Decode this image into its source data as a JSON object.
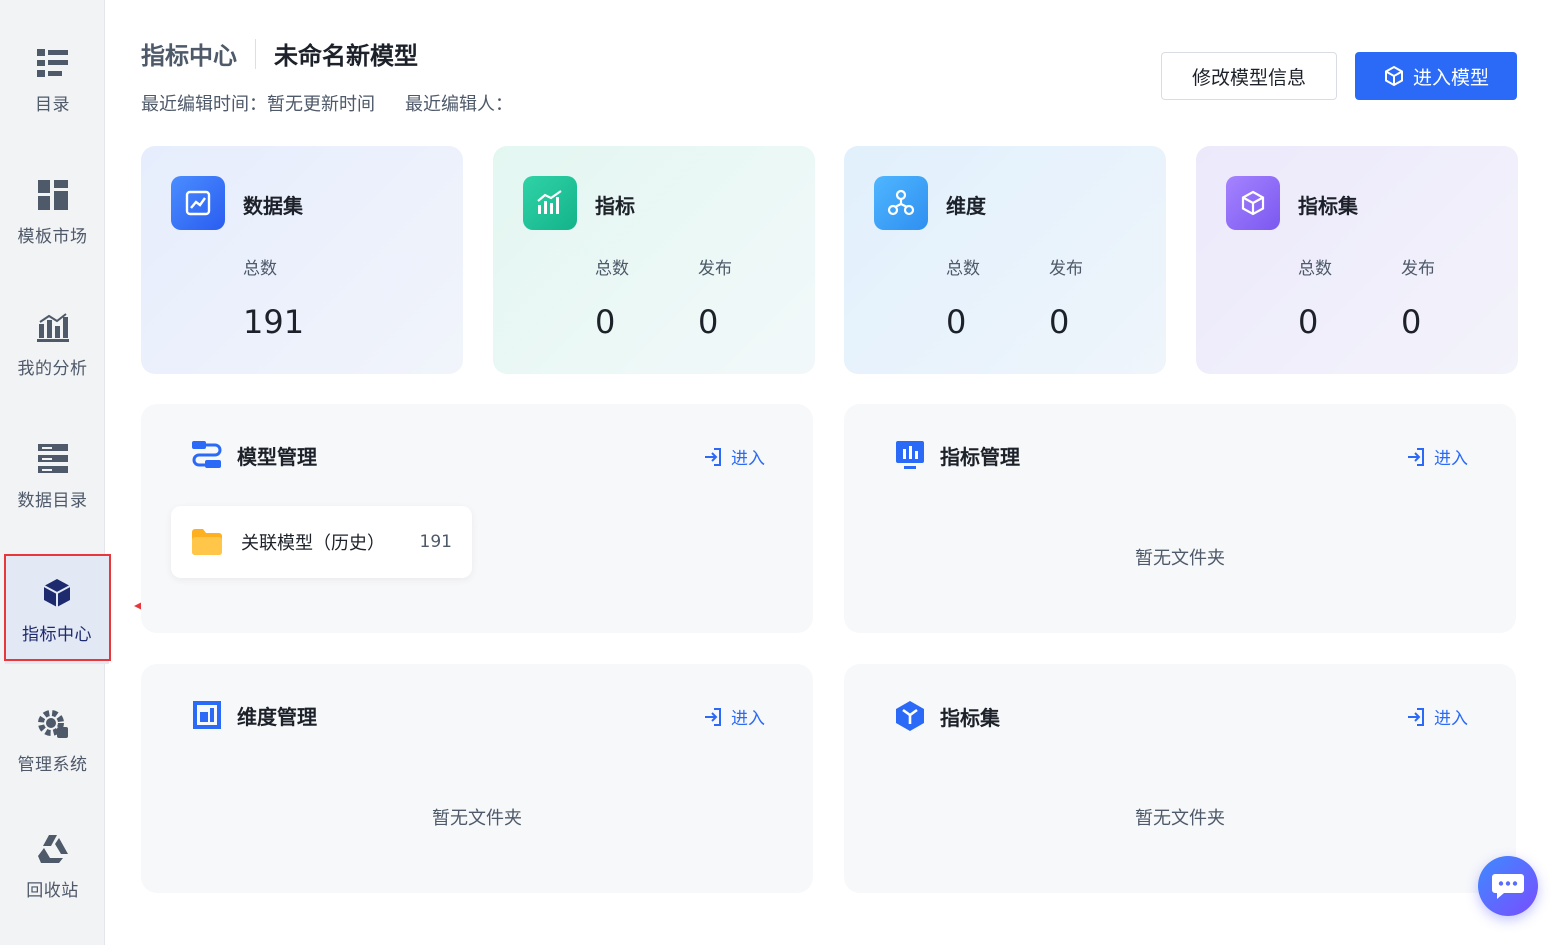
{
  "sidebar": {
    "items": [
      {
        "label": "目录",
        "icon": "list-icon"
      },
      {
        "label": "模板市场",
        "icon": "template-grid-icon"
      },
      {
        "label": "我的分析",
        "icon": "bar-chart-icon"
      },
      {
        "label": "数据目录",
        "icon": "data-catalog-icon"
      },
      {
        "label": "指标中心",
        "icon": "cube-icon",
        "active": true
      },
      {
        "label": "管理系统",
        "icon": "gear-icon"
      },
      {
        "label": "回收站",
        "icon": "recycle-icon"
      }
    ]
  },
  "header": {
    "crumb": "指标中心",
    "model_name": "未命名新模型",
    "edit_time": "最近编辑时间：暂无更新时间",
    "editor": "最近编辑人："
  },
  "buttons": {
    "edit_model": "修改模型信息",
    "enter_model": "进入模型"
  },
  "stats": {
    "dataset": {
      "title": "数据集",
      "total_label": "总数",
      "total": "191"
    },
    "metric": {
      "title": "指标",
      "total_label": "总数",
      "total": "0",
      "published_label": "发布",
      "published": "0"
    },
    "dimension": {
      "title": "维度",
      "total_label": "总数",
      "total": "0",
      "published_label": "发布",
      "published": "0"
    },
    "metric_set": {
      "title": "指标集",
      "total_label": "总数",
      "total": "0",
      "published_label": "发布",
      "published": "0"
    }
  },
  "panels": {
    "model_mgmt": {
      "title": "模型管理",
      "enter": "进入",
      "folder_name": "关联模型（历史）",
      "folder_count": "191"
    },
    "metric_mgmt": {
      "title": "指标管理",
      "enter": "进入",
      "empty": "暂无文件夹"
    },
    "dim_mgmt": {
      "title": "维度管理",
      "enter": "进入",
      "empty": "暂无文件夹"
    },
    "metric_set": {
      "title": "指标集",
      "enter": "进入",
      "empty": "暂无文件夹"
    }
  },
  "colors": {
    "accent": "#2a6af7",
    "annotation": "#e8373a"
  }
}
